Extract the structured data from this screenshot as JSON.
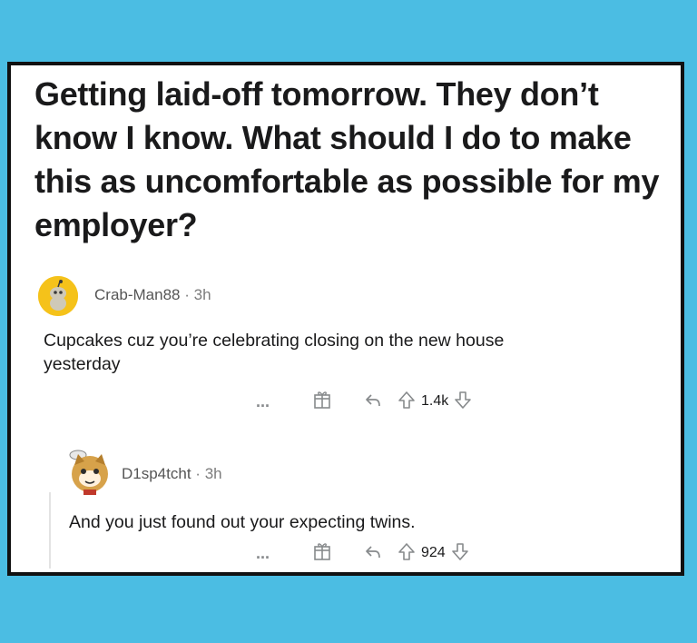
{
  "post": {
    "title": "Getting laid-off tomorrow. They don’t know I know. What should I do to make this as uncomfortable as possible for my employer?"
  },
  "comments": [
    {
      "username": "Crab-Man88",
      "separator": "·",
      "time": "3h",
      "body": "Cupcakes cuz you’re celebrating closing on the new house yesterday",
      "more": "...",
      "score": "1.4k",
      "avatar_color": "#f5c21a"
    },
    {
      "username": "D1sp4tcht",
      "separator": "·",
      "time": "3h",
      "body": "And you just found out your expecting twins.",
      "more": "...",
      "score": "924",
      "avatar_color": "#d7a24a"
    }
  ],
  "icons": [
    "more-icon",
    "award-icon",
    "reply-icon",
    "upvote-icon",
    "downvote-icon"
  ],
  "colors": {
    "background": "#4bbde3",
    "card": "#ffffff",
    "border": "#111111",
    "meta_text": "#7c7c7c"
  }
}
